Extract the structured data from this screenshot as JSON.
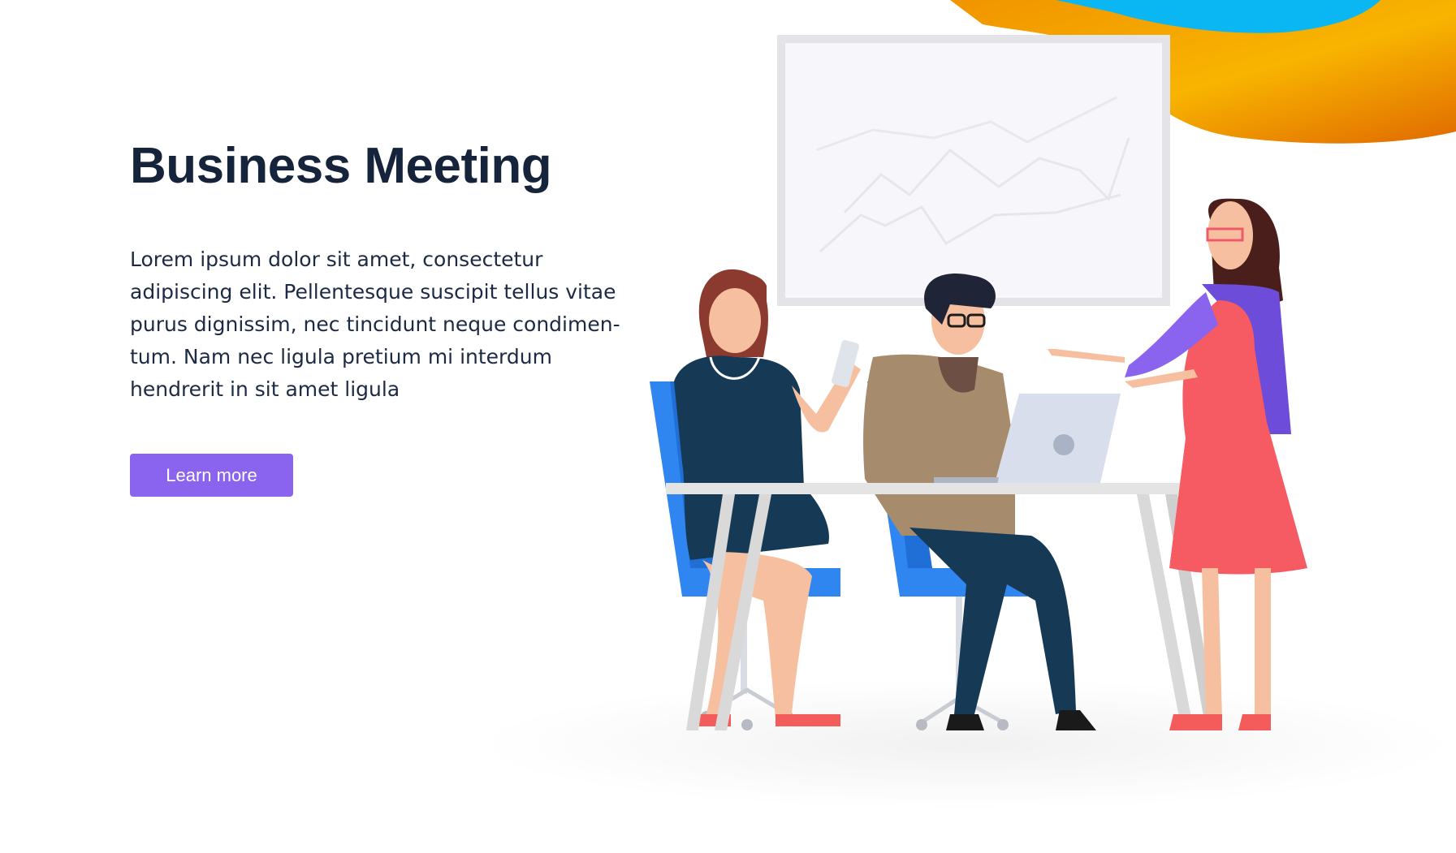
{
  "hero": {
    "title": "Business Meeting",
    "body_lines": [
      "Lorem ipsum dolor sit amet, consectetur",
      "adipiscing elit. Pellentesque suscipit tellus vitae",
      "purus dignissim, nec tincidunt neque condimen-",
      "tum. Nam nec ligula pretium mi interdum",
      "hendrerit in sit amet ligula"
    ],
    "cta_label": "Learn more"
  },
  "colors": {
    "title": "#15233b",
    "body": "#1c2a44",
    "cta": "#8a63ee",
    "blob_orange": "#f7a600",
    "blob_blue": "#0bb7f2",
    "chair": "#2f86f0"
  },
  "illustration": {
    "subject": "people-meeting-at-table",
    "icons": [
      "whiteboard-icon",
      "laptop-icon",
      "phone-icon",
      "chair-icon"
    ]
  }
}
